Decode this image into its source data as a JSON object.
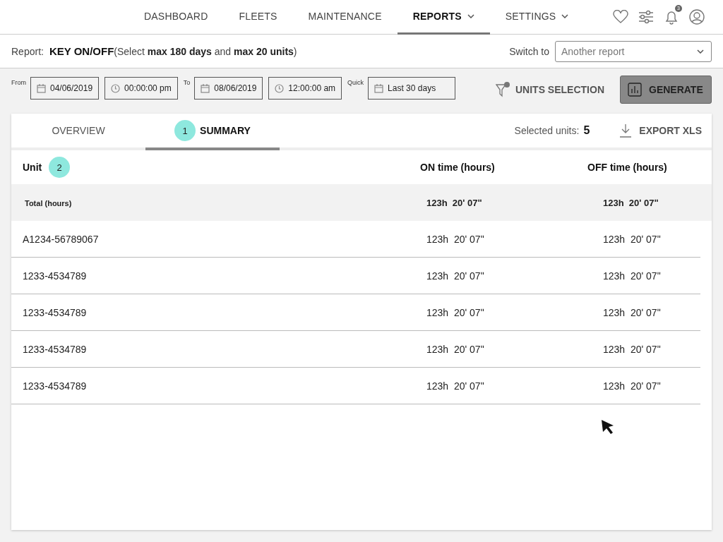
{
  "nav": {
    "items": [
      {
        "label": "DASHBOARD",
        "selected": false,
        "dropdown": false
      },
      {
        "label": "FLEETS",
        "selected": false,
        "dropdown": false
      },
      {
        "label": "MAINTENANCE",
        "selected": false,
        "dropdown": false
      },
      {
        "label": "REPORTS",
        "selected": true,
        "dropdown": true
      },
      {
        "label": "SETTINGS",
        "selected": false,
        "dropdown": true
      }
    ],
    "notification_count": "3"
  },
  "report": {
    "label": "Report:",
    "name": "KEY ON/OFF",
    "note": "(Select **max 180 days** and **max 20 units**)",
    "switch_label": "Switch to",
    "switch_placeholder": "Another report"
  },
  "filters": [
    {
      "label": "From",
      "fields": [
        {
          "kind": "date",
          "value": "04/06/2019"
        },
        {
          "kind": "time",
          "value": "00:00:00 pm"
        }
      ]
    },
    {
      "label": "To",
      "fields": [
        {
          "kind": "date",
          "value": "08/06/2019"
        },
        {
          "kind": "time",
          "value": "12:00:00 am"
        }
      ]
    },
    {
      "label": "Quick",
      "fields": [
        {
          "kind": "date",
          "value": "Last 30 days"
        }
      ]
    }
  ],
  "units_selection": "UNITS SELECTION",
  "generate": "GENERATE",
  "tabs": [
    {
      "label": "OVERVIEW",
      "selected": false
    },
    {
      "label": "SUMMARY",
      "selected": true,
      "badge": "1"
    }
  ],
  "selected_units": {
    "label": "Selected units:",
    "count": "5"
  },
  "export": "EXPORT XLS",
  "table": {
    "columns": [
      {
        "label": "Unit",
        "badge": "2"
      },
      {
        "label": "ON time (hours)"
      },
      {
        "label": "OFF time (hours)"
      }
    ],
    "total": [
      "Total (hours)",
      "123h  20ʹ 07ʺ",
      "123h  20ʹ 07ʺ"
    ],
    "rows": [
      [
        "A1234-56789067",
        "123h  20ʹ 07ʺ",
        "123h  20ʹ 07ʺ"
      ],
      [
        "1233-4534789",
        "123h  20ʹ 07ʺ",
        "123h  20ʹ 07ʺ"
      ],
      [
        "1233-4534789",
        "123h  20ʹ 07ʺ",
        "123h  20ʹ 07ʺ"
      ],
      [
        "1233-4534789",
        "123h  20ʹ 07ʺ",
        "123h  20ʹ 07ʺ"
      ],
      [
        "1233-4534789",
        "123h  20ʹ 07ʺ",
        "123h  20ʹ 07ʺ"
      ]
    ]
  }
}
